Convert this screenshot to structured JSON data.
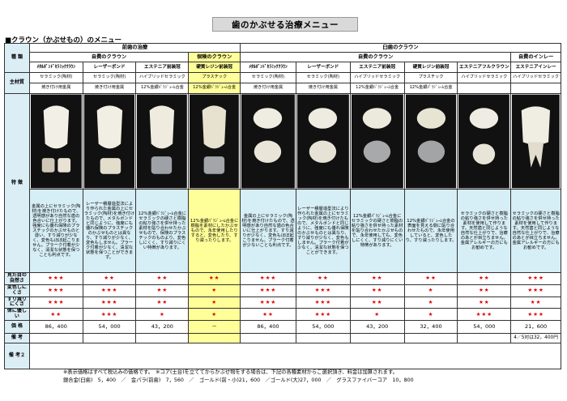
{
  "header": {
    "title": "歯のかぶせる治療メニュー",
    "subtitle": "■クラウン（かぶせもの）のメニュー"
  },
  "rows": {
    "type": "種 類",
    "material": "主材質",
    "feature": "特 徴",
    "look": "見た目の自然さ",
    "color_change": "変色しにくさ",
    "wear": "すり減りにくさ",
    "body": "体に優しい",
    "price": "価 格",
    "note1": "備 考",
    "note2": "備 考２"
  },
  "sections": {
    "front": "前歯の治療",
    "back": "臼歯のクラウン"
  },
  "categories": {
    "front_private": "自費のクラウン",
    "front_insurance": "保険のクラウン",
    "back_private": "自費のクラウン",
    "back_inlay": "自費のインレー"
  },
  "columns": [
    {
      "name": "ﾒﾀﾙﾎﾞﾝﾄﾞｾﾗﾐｯｸｸﾗｳﾝ",
      "mat1": "セラミック(陶材)",
      "mat2": "焼き付け用金属",
      "desc": "金属の上にセラミック(陶材)を焼き付けたもので、透明感があり自然な歯の色合いに仕上がります。強度にも優れ保険のプラスチックのかぶせものと違い、すり減りが少なく、変色もほぼ起こりません。プラーク付着が少なく、清潔な状態を保つことも利点です。",
      "look": "★★★",
      "color": "★★★",
      "wear": "★★★",
      "body": "★★",
      "price": "86，400"
    },
    {
      "name": "レーザーボンド",
      "mat1": "セラミック(陶材)",
      "mat2": "焼き付け用金属",
      "desc": "レーザー積層造型法により作られた金属の上にセラミック(陶材)を焼き付けたもので、メタルボンドと同じように、強度にも優れ保険のプラスチックのかぶせものとは異なり、すり減りが少なく、変色もしません。プラーク付着が少なく、清潔な状態を保つことができます。",
      "look": "★★",
      "color": "★★★",
      "wear": "★★★",
      "body": "★★★",
      "price": "54，000"
    },
    {
      "name": "エステニア前装冠",
      "mat1": "ハイブリッドセラミック",
      "mat2": "12%金銀ﾊﾟﾗｼﾞｭｰﾑ合金",
      "desc": "12%金銀ﾊﾟﾗｼﾞｭｰﾑ合金にセラミックの硬さと樹脂の粘り強さを併せ持った素材を貼り合わせたかぶせもので、保険のプラスチックのものより、変色しにくく、すり減りにくい特徴があります。",
      "look": "★★",
      "color": "★★",
      "wear": "★★",
      "body": "★",
      "price": "43，200"
    },
    {
      "name": "硬質レジン前装冠",
      "mat1": "プラスチック",
      "mat2": "12%金銀ﾊﾟﾗｼﾞｭｰﾑ合金",
      "desc": "12%金銀ﾊﾟﾗｼﾞｭｰﾑ合金に樹脂を素材にしたかぶせもので、永年使用したりすると、変色したり、すり減ったりします。",
      "look": "★★",
      "color": "★",
      "wear": "★",
      "body": "★",
      "price": "－"
    },
    {
      "name": "ﾒﾀﾙﾎﾞﾝﾄﾞｾﾗﾐｯｸｸﾗｳﾝ",
      "mat1": "セラミック(陶材)",
      "mat2": "焼き付け用金属",
      "desc": "金属の上にセラミック(陶材)を焼き付けたもので、透明感があり自然な歯の色合いに仕上がります。すり減りが少なく、変色もほぼ起こりません。プラーク付着が少ないことも利点です。",
      "look": "★★★",
      "color": "★★★",
      "wear": "★★★",
      "body": "★★",
      "price": "86，400"
    },
    {
      "name": "レーザーボンド",
      "mat1": "セラミック(陶材)",
      "mat2": "焼き付け用金属",
      "desc": "レーザー積層造型法により作られた金属の上にセラミック(陶材)を焼き付けたもので、メタルボンドと同じように、強度にも優れ保険のかぶせものとは異なり、すり減りが少なく、変色もしません。プラーク付着が少なく、清潔な状態を保つことができます。",
      "look": "★★",
      "color": "★★★",
      "wear": "★★★",
      "body": "★★★",
      "price": "54，000"
    },
    {
      "name": "エステニア前装冠",
      "mat1": "ハイブリッドセラミック",
      "mat2": "12%金銀ﾊﾟﾗｼﾞｭｰﾑ合金",
      "desc": "12%金銀ﾊﾟﾗｼﾞｭｰﾑ合金にセラミックの硬さと樹脂の粘り強さを併せ持った素材を貼り合わせたかぶせもので、永年使用しても、変色しにくく、すり減りにくい特徴があります。",
      "look": "★★",
      "color": "★★",
      "wear": "★★",
      "body": "★",
      "price": "43，200"
    },
    {
      "name": "硬質レジン前装冠",
      "mat1": "プラスチック",
      "mat2": "12%金銀ﾊﾟﾗｼﾞｭｰﾑ合金",
      "desc": "12%金銀ﾊﾟﾗｼﾞｭｰﾑ合金の表面を見える側に貼り合わせたもので、永年使用していると、変色したり、すり減ったりします。",
      "look": "★★",
      "color": "★",
      "wear": "★",
      "body": "★",
      "price": "32，400"
    },
    {
      "name": "エステニアフルクラウン",
      "mat1": "ハイブリッドセラミック",
      "mat2": "",
      "desc": "セラミックの硬さと樹脂の粘り強さを併せ持った素材を使用して作ります。天然歯と同じような自然な仕上がりで、治療のあとが目立ちません。金属アレルギーの方にもお勧めです。",
      "look": "★★",
      "color": "★★",
      "wear": "★★",
      "body": "★★★",
      "price": "54，000"
    },
    {
      "name": "エステニアインレー",
      "mat1": "ハイブリッドセラミック",
      "mat2": "",
      "desc": "セラミックの硬さと樹脂の粘り強さを併せ持った素材を使用して作ります。天然歯と同じような自然な仕上がりで、治療のあとが目立ちません。金属アレルギーの方にもお勧めです。",
      "look": "★★★",
      "color": "★★★",
      "wear": "★★",
      "body": "★★★",
      "price": "21，600"
    }
  ],
  "inlay_note": "4／5対は32，400円",
  "remarks": {
    "line1": "※表示価格はすべて税込みの価格です。　※コア(土台)を立ててからかぶせ物をする場合は、下記の各種素材からご選択頂き、料金は加算されます。",
    "line2": "銀合金(臼歯)　5，400　／　金パラ(前歯)　7，560　／　ゴールド(前・小)21，600　／ゴールド(大)27，000　／　グラスファイバーコア　10，800"
  },
  "colors": {
    "label_bg": "#dbeef6",
    "highlight": "#ffff99",
    "star": "#e00000"
  }
}
